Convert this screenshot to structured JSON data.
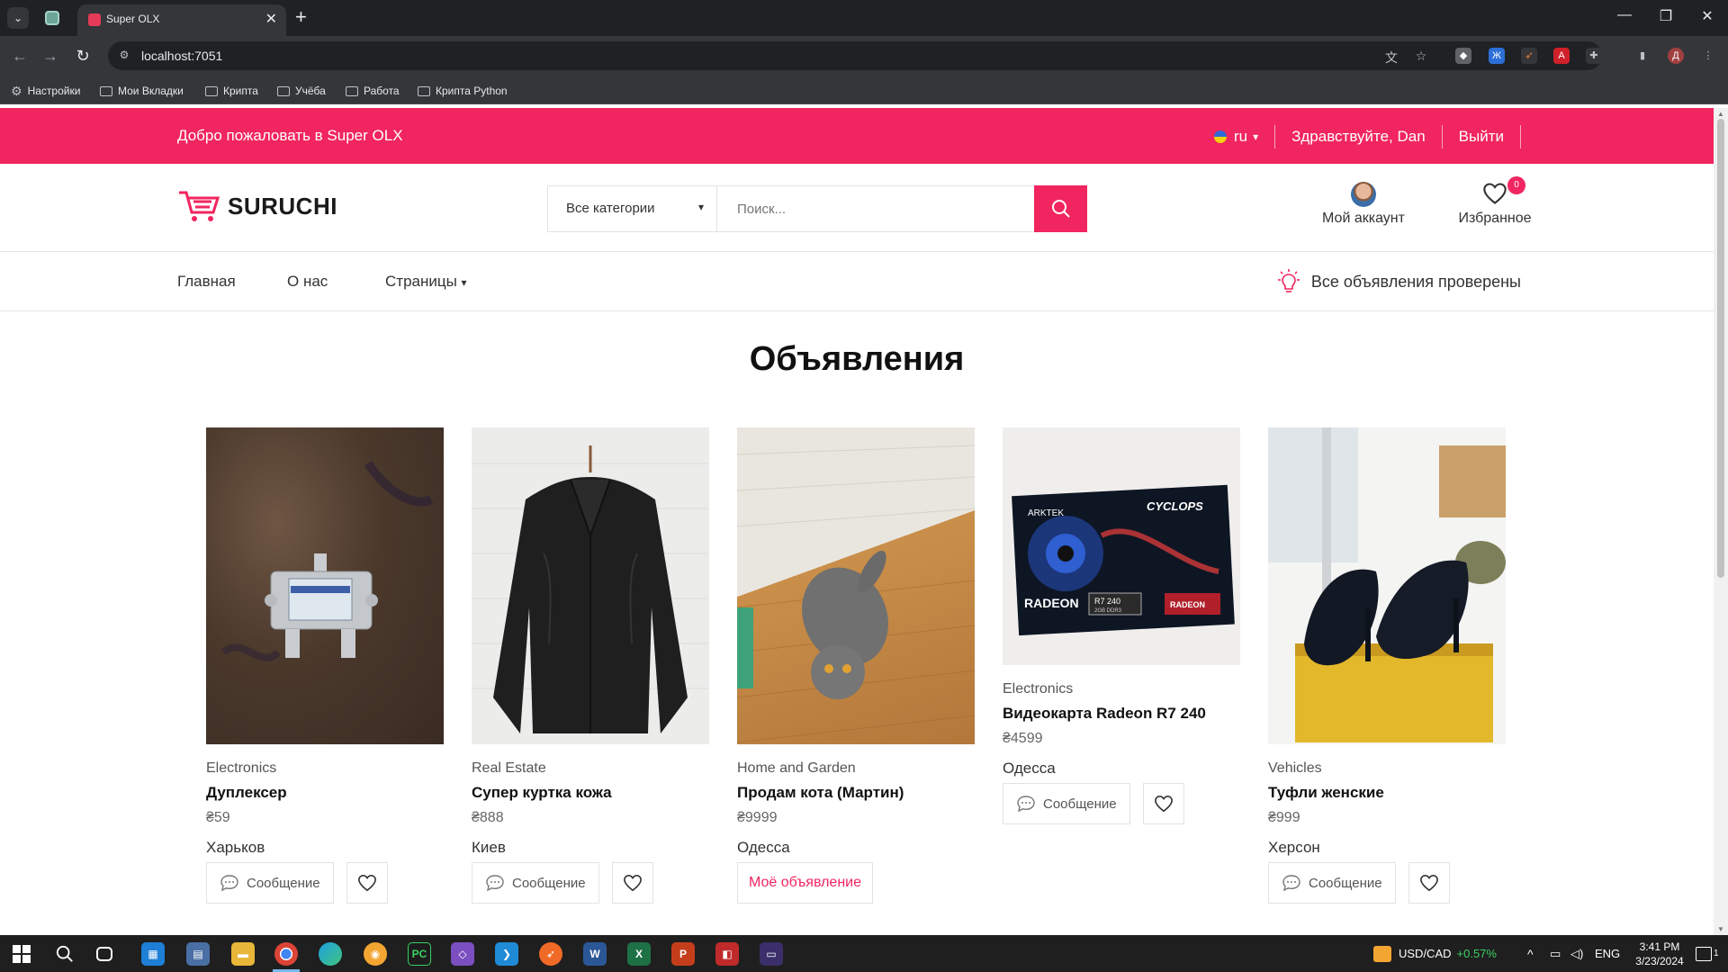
{
  "browser": {
    "tab_title": "Super OLX",
    "close_glyph": "✕",
    "newtab_glyph": "+",
    "url": "localhost:7051",
    "bookmarks": [
      "Настройки",
      "Мои Вкладки",
      "Крипта",
      "Учёба",
      "Работа",
      "Крипта Python"
    ]
  },
  "topbar": {
    "welcome": "Добро пожаловать в Super OLX",
    "language": "ru",
    "greeting": "Здравствуйте, Dan",
    "logout": "Выйти"
  },
  "header": {
    "logo_text": "SURUCHI",
    "category_select": "Все категории",
    "search_placeholder": "Поиск...",
    "account_label": "Мой аккаунт",
    "favorites_label": "Избранное",
    "favorites_count": "0"
  },
  "nav": {
    "home": "Главная",
    "about": "О нас",
    "pages": "Страницы",
    "verified_note": "Все объявления проверены"
  },
  "listings_title": "Объявления",
  "message_label": "Сообщение",
  "my_listing_label": "Моё объявление",
  "listings": [
    {
      "category": "Electronics",
      "title": "Дуплексер",
      "price": "₴59",
      "city": "Харьков",
      "own": false
    },
    {
      "category": "Real Estate",
      "title": "Супер куртка кожа",
      "price": "₴888",
      "city": "Киев",
      "own": false
    },
    {
      "category": "Home and Garden",
      "title": "Продам кота (Мартин)",
      "price": "₴9999",
      "city": "Одесса",
      "own": true
    },
    {
      "category": "Electronics",
      "title": "Видеокарта Radeon R7 240",
      "price": "₴4599",
      "city": "Одесса",
      "own": false
    },
    {
      "category": "Vehicles",
      "title": "Туфли женские",
      "price": "₴999",
      "city": "Херсон",
      "own": false
    }
  ],
  "gpu_box": {
    "brand": "ARKTEK",
    "series": "CYCLOPS",
    "radeon": "RADEON",
    "model": "R7 240",
    "mem": "2GB DDR3"
  },
  "taskbar": {
    "ticker": "USD/CAD",
    "ticker_change": "+0.57%",
    "lang": "ENG",
    "time": "3:41 PM",
    "date": "3/23/2024",
    "notif_count": "1"
  },
  "colors": {
    "accent": "#f1255f",
    "chrome_dark": "#202124",
    "chrome_mid": "#35363a"
  }
}
